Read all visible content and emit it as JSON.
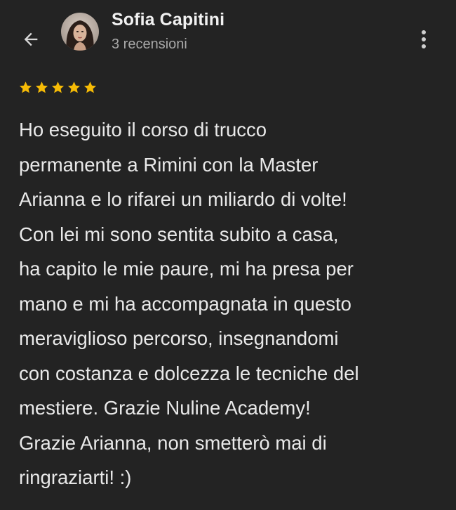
{
  "header": {
    "back_icon": "arrow-left-icon",
    "author_name": "Sofia Capitini",
    "review_count": "3 recensioni",
    "more_icon": "more-vert-icon"
  },
  "review": {
    "rating": 5,
    "rating_max": 5,
    "star_color": "#f6bb06",
    "text": "Ho eseguito il corso di trucco\npermanente a Rimini con la Master\nArianna e lo rifarei un miliardo di volte!\nCon lei mi sono sentita subito a casa,\nha capito le mie paure, mi ha presa per\nmano e mi ha accompagnata in questo\nmeraviglioso percorso, insegnandomi\ncon costanza e dolcezza le tecniche del\nmestiere. Grazie Nuline Academy!\nGrazie Arianna, non smetterò mai di\nringraziarti! :)"
  },
  "colors": {
    "background": "#232323",
    "text_primary": "#e9e9e9",
    "text_secondary": "#a8a8a8"
  }
}
